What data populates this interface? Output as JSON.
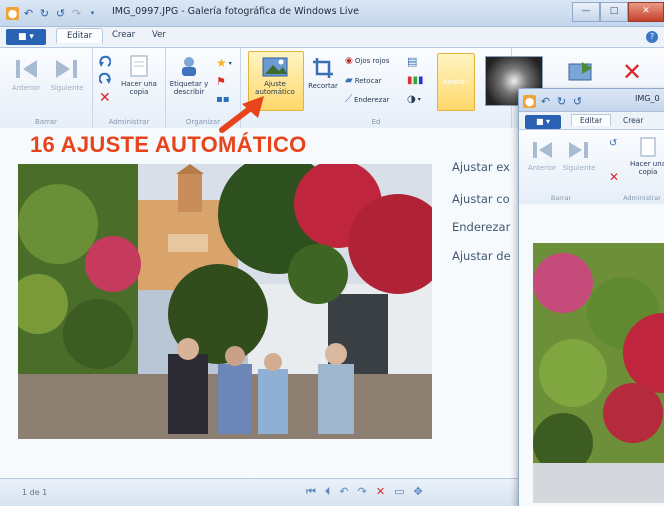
{
  "window": {
    "title": "IMG_0997.JPG - Galería fotográfica de Windows Live",
    "controls": {
      "minimize": "—",
      "maximize": "□",
      "close": "✕"
    }
  },
  "tabs": {
    "file": "■ ▾",
    "items": [
      "Editar",
      "Crear",
      "Ver"
    ],
    "active": "Editar"
  },
  "ribbon": {
    "nav": {
      "prev": "Anterior",
      "next": "Siguiente",
      "group": "Barrar"
    },
    "admin": {
      "copy": "Hacer una copia",
      "group": "Administrar"
    },
    "organize": {
      "tag": "Etiquetar y describir",
      "group": "Organizar"
    },
    "adjust": {
      "auto": "Ajuste automático",
      "crop": "Recortar",
      "red_eye": "Ojos rojos",
      "retouch": "Retocar",
      "straighten": "Enderezar",
      "adjust": "Ajustar",
      "group": "Ed"
    }
  },
  "annotation": {
    "text": "16 AJUSTE AUTOMÁTICO",
    "color": "#e8441c"
  },
  "side_menu": [
    "Ajustar ex",
    "Ajustar co",
    "Enderezar",
    "Ajustar de"
  ],
  "status": {
    "counter": "1 de 1"
  },
  "window2": {
    "title": "IMG_0",
    "tabs": [
      "Editar",
      "Crear"
    ],
    "nav": {
      "prev": "Anterior",
      "next": "Siguiente",
      "group": "Barrar"
    },
    "admin": {
      "copy": "Hacer una copia",
      "group": "Administrar"
    }
  },
  "colors": {
    "accent": "#2a62b3",
    "highlight": "#ffd86b",
    "annotation": "#e8441c"
  }
}
